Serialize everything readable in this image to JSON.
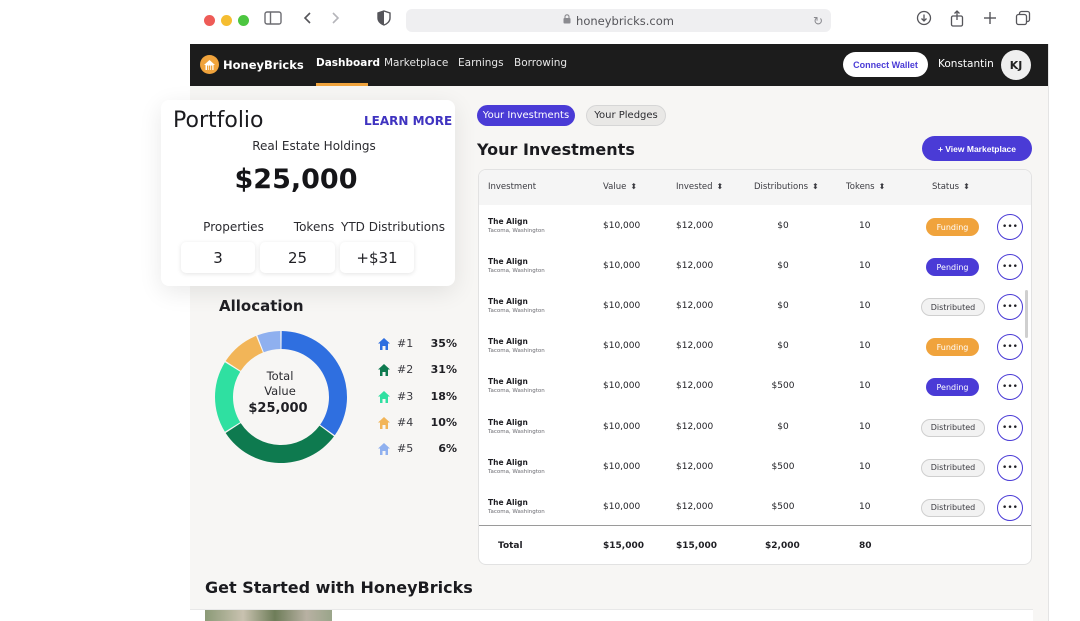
{
  "browser": {
    "url": "honeybricks.com"
  },
  "nav": {
    "brand": "HoneyBricks",
    "links": [
      "Dashboard",
      "Marketplace",
      "Earnings",
      "Borrowing"
    ],
    "connect_label": "Connect Wallet",
    "user_name": "Konstantin",
    "avatar_initials": "KJ"
  },
  "portfolio": {
    "title": "Portfolio",
    "learn_more": "LEARN MORE",
    "subtitle": "Real Estate Holdings",
    "total": "$25,000",
    "stats": [
      {
        "label": "Properties",
        "value": "3"
      },
      {
        "label": "Tokens",
        "value": "25"
      },
      {
        "label": "YTD Distributions",
        "value": "+$31"
      }
    ]
  },
  "allocation": {
    "title": "Allocation",
    "center_line1": "Total",
    "center_line2": "Value",
    "center_value": "$25,000",
    "items": [
      {
        "rank": "#1",
        "pct": "35%",
        "fraction": 0.35,
        "color": "#2f6fe0"
      },
      {
        "rank": "#2",
        "pct": "31%",
        "fraction": 0.31,
        "color": "#0e7a4f"
      },
      {
        "rank": "#3",
        "pct": "18%",
        "fraction": 0.18,
        "color": "#2fe0a1"
      },
      {
        "rank": "#4",
        "pct": "10%",
        "fraction": 0.1,
        "color": "#f2b558"
      },
      {
        "rank": "#5",
        "pct": "6%",
        "fraction": 0.06,
        "color": "#8fb0ef"
      }
    ]
  },
  "tabs": {
    "active": "Your Investments",
    "inactive": "Your Pledges"
  },
  "investments": {
    "title": "Your Investments",
    "view_marketplace": "+ View Marketplace",
    "columns": [
      "Investment",
      "Value",
      "Invested",
      "Distributions",
      "Tokens",
      "Status"
    ],
    "rows": [
      {
        "name": "The Align",
        "location": "Tacoma, Washington",
        "value": "$10,000",
        "invested": "$12,000",
        "distributions": "$0",
        "tokens": "10",
        "status": "Funding"
      },
      {
        "name": "The Align",
        "location": "Tacoma, Washington",
        "value": "$10,000",
        "invested": "$12,000",
        "distributions": "$0",
        "tokens": "10",
        "status": "Pending"
      },
      {
        "name": "The Align",
        "location": "Tacoma, Washington",
        "value": "$10,000",
        "invested": "$12,000",
        "distributions": "$0",
        "tokens": "10",
        "status": "Distributed"
      },
      {
        "name": "The Align",
        "location": "Tacoma, Washington",
        "value": "$10,000",
        "invested": "$12,000",
        "distributions": "$0",
        "tokens": "10",
        "status": "Funding"
      },
      {
        "name": "The Align",
        "location": "Tacoma, Washington",
        "value": "$10,000",
        "invested": "$12,000",
        "distributions": "$500",
        "tokens": "10",
        "status": "Pending"
      },
      {
        "name": "The Align",
        "location": "Tacoma, Washington",
        "value": "$10,000",
        "invested": "$12,000",
        "distributions": "$0",
        "tokens": "10",
        "status": "Distributed"
      },
      {
        "name": "The Align",
        "location": "Tacoma, Washington",
        "value": "$10,000",
        "invested": "$12,000",
        "distributions": "$500",
        "tokens": "10",
        "status": "Distributed"
      },
      {
        "name": "The Align",
        "location": "Tacoma, Washington",
        "value": "$10,000",
        "invested": "$12,000",
        "distributions": "$500",
        "tokens": "10",
        "status": "Distributed"
      }
    ],
    "more_label": "•••",
    "total": {
      "label": "Total",
      "value": "$15,000",
      "invested": "$15,000",
      "distributions": "$2,000",
      "tokens": "80"
    }
  },
  "get_started": {
    "title": "Get Started with HoneyBricks"
  }
}
